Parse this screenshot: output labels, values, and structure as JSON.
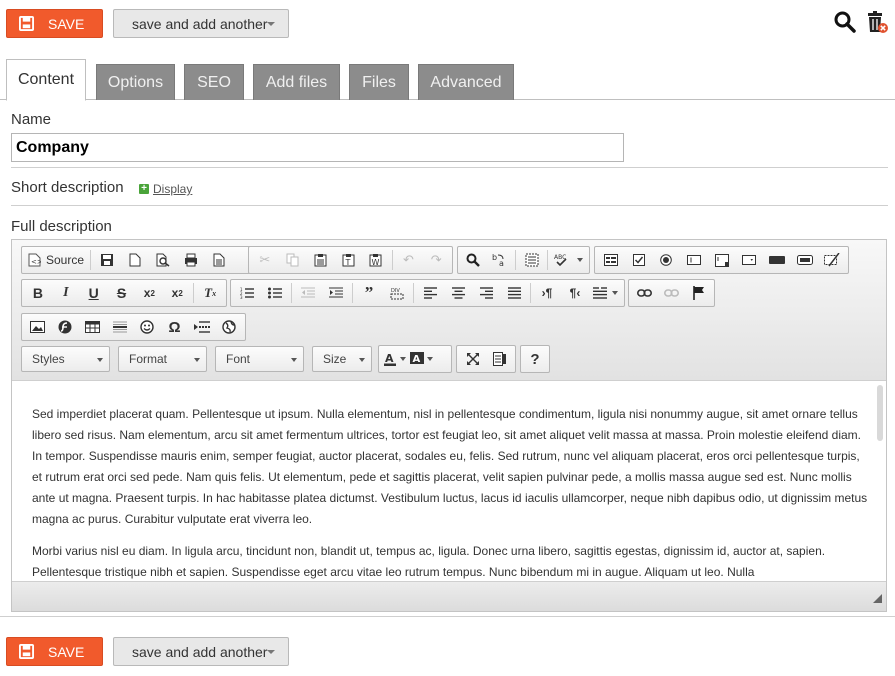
{
  "actions": {
    "save_label": "SAVE",
    "save_add_label": "save and add another"
  },
  "tabs": [
    {
      "label": "Content",
      "active": true
    },
    {
      "label": "Options",
      "active": false
    },
    {
      "label": "SEO",
      "active": false
    },
    {
      "label": "Add files",
      "active": false
    },
    {
      "label": "Files",
      "active": false
    },
    {
      "label": "Advanced",
      "active": false
    }
  ],
  "form": {
    "name_label": "Name",
    "name_value": "Company",
    "short_description_label": "Short description",
    "display_link": "Display",
    "full_description_label": "Full description"
  },
  "toolbar": {
    "source_label": "Source",
    "styles_label": "Styles",
    "format_label": "Format",
    "font_label": "Font",
    "size_label": "Size",
    "help_label": "?"
  },
  "editor": {
    "paragraphs": [
      "Sed imperdiet placerat quam. Pellentesque ut ipsum. Nulla elementum, nisl in pellentesque condimentum, ligula nisi nonummy augue, sit amet ornare tellus libero sed risus. Nam elementum, arcu sit amet fermentum ultrices, tortor est feugiat leo, sit amet aliquet velit massa at massa. Proin molestie eleifend diam. In tempor. Suspendisse mauris enim, semper feugiat, auctor placerat, sodales eu, felis. Sed rutrum, nunc vel aliquam placerat, eros orci pellentesque turpis, et rutrum erat orci sed pede. Nam quis felis. Ut elementum, pede et sagittis placerat, velit sapien pulvinar pede, a mollis massa augue sed est. Nunc mollis ante ut magna. Praesent turpis. In hac habitasse platea dictumst. Vestibulum luctus, lacus id iaculis ullamcorper, neque nibh dapibus odio, ut dignissim metus magna ac purus. Curabitur vulputate erat viverra leo.",
      "Morbi varius nisl eu diam. In ligula arcu, tincidunt non, blandit ut, tempus ac, ligula. Donec urna libero, sagittis egestas, dignissim id, auctor at, sapien. Pellentesque tristique nibh et sapien. Suspendisse eget arcu vitae leo rutrum tempus. Nunc bibendum mi in augue. Aliquam ut leo. Nulla"
    ]
  },
  "colors": {
    "accent": "#f15a2c",
    "tab_inactive": "#8c8c8c",
    "add_icon": "#4aa43a"
  }
}
